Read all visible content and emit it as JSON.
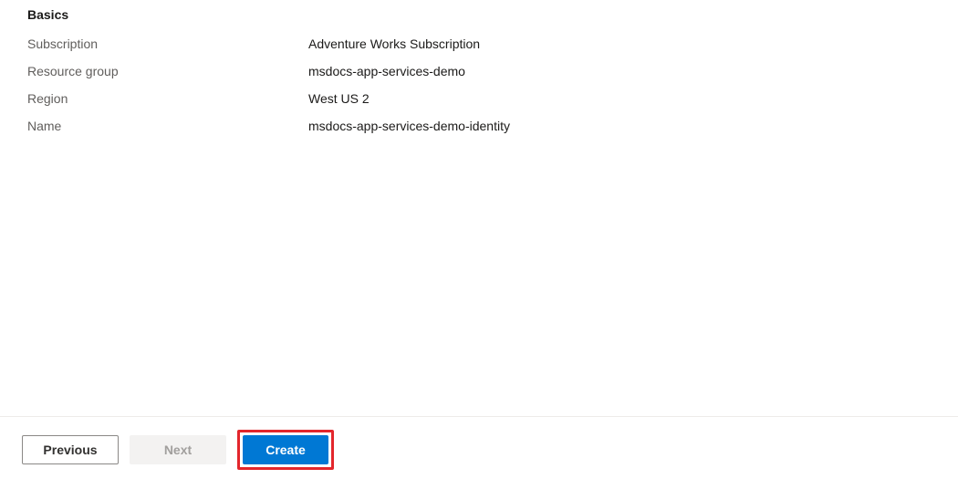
{
  "section": {
    "heading": "Basics",
    "rows": [
      {
        "label": "Subscription",
        "value": "Adventure Works Subscription"
      },
      {
        "label": "Resource group",
        "value": "msdocs-app-services-demo"
      },
      {
        "label": "Region",
        "value": "West US 2"
      },
      {
        "label": "Name",
        "value": "msdocs-app-services-demo-identity"
      }
    ]
  },
  "footer": {
    "previous_label": "Previous",
    "next_label": "Next",
    "create_label": "Create"
  }
}
